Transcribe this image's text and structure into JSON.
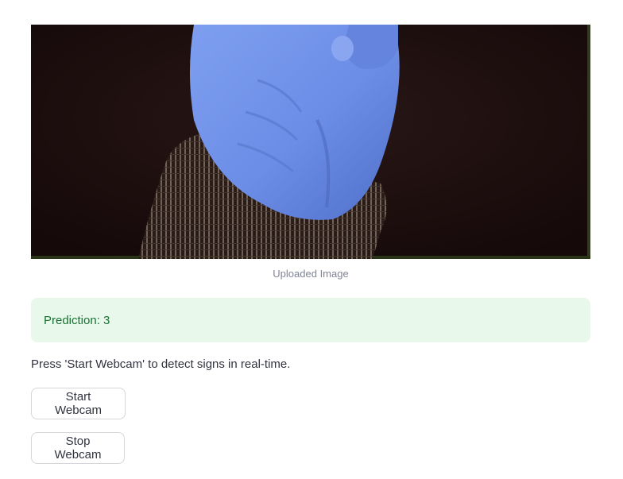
{
  "image": {
    "caption": "Uploaded Image",
    "subject": "hand-sign-photo"
  },
  "prediction": {
    "text": "Prediction: 3",
    "status_color": "#177233",
    "background_color": "#e8f8ea"
  },
  "webcam": {
    "instructions": "Press 'Start Webcam' to detect signs in real-time.",
    "start_label": "Start Webcam",
    "stop_label": "Stop Webcam"
  }
}
